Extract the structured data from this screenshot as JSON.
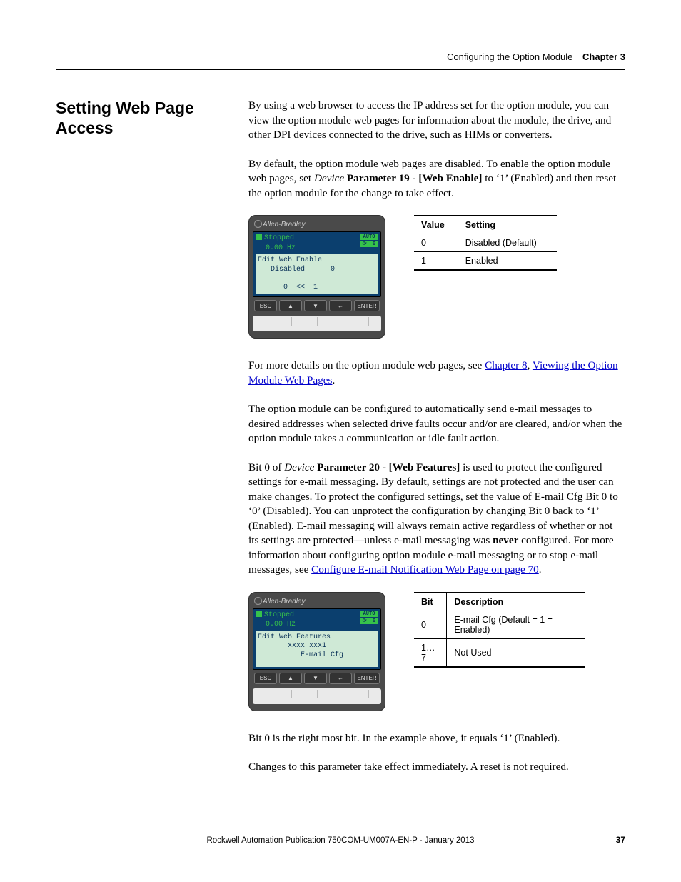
{
  "header": {
    "section": "Configuring the Option Module",
    "chapter": "Chapter 3"
  },
  "heading": "Setting Web Page Access",
  "p1": "By using a web browser to access the IP address set for the option module, you can view the option module web pages for information about the module, the drive, and other DPI devices connected to the drive, such as HIMs or converters.",
  "p2_a": "By default, the option module web pages are disabled. To enable the option module web pages, set ",
  "p2_device": "Device",
  "p2_param": " Parameter 19 - [Web Enable]",
  "p2_b": " to ‘1’ (Enabled) and then reset the option module for the change to take effect.",
  "him1": {
    "brand": "Allen-Bradley",
    "status1": "Stopped",
    "status2": "0.00 Hz",
    "badge1": "AUTO",
    "body": "Edit Web Enable\n   Disabled      0\n\n      0  <<  1",
    "keys": {
      "esc": "ESC",
      "up": "▲",
      "down": "▼",
      "left": "←",
      "enter": "ENTER"
    }
  },
  "table1": {
    "h1": "Value",
    "h2": "Setting",
    "rows": [
      {
        "v": "0",
        "s": "Disabled (Default)"
      },
      {
        "v": "1",
        "s": "Enabled"
      }
    ]
  },
  "p3_a": "For more details on the option module web pages, see ",
  "p3_link1": "Chapter 8",
  "p3_mid": ", ",
  "p3_link2": "Viewing the Option Module Web Pages",
  "p3_end": ".",
  "p4": "The option module can be configured to automatically send e-mail messages to desired addresses when selected drive faults occur and/or are cleared, and/or when the option module takes a communication or idle fault action.",
  "p5_a": "Bit 0 of ",
  "p5_device": "Device",
  "p5_param": " Parameter 20 - [Web Features]",
  "p5_b": " is used to protect the configured settings for e-mail messaging. By default, settings are not protected and the user can make changes. To protect the configured settings, set the value of E-mail Cfg Bit 0 to ‘0’ (Disabled). You can unprotect the configuration by changing Bit 0 back to ‘1’ (Enabled). E-mail messaging will always remain active regardless of whether or not its settings are protected—unless e-mail messaging was ",
  "p5_never": "never",
  "p5_c": " configured. For more information about configuring option module e-mail messaging or to stop e-mail messages, see ",
  "p5_link": "Configure E-mail Notification Web Page on page 70",
  "p5_end": ".",
  "him2": {
    "brand": "Allen-Bradley",
    "status1": "Stopped",
    "status2": "0.00 Hz",
    "badge1": "AUTO",
    "body": "Edit Web Features\n       xxxx xxx1\n          E-mail Cfg",
    "keys": {
      "esc": "ESC",
      "up": "▲",
      "down": "▼",
      "left": "←",
      "enter": "ENTER"
    }
  },
  "table2": {
    "h1": "Bit",
    "h2": "Description",
    "rows": [
      {
        "v": "0",
        "s": "E-mail Cfg (Default = 1 = Enabled)"
      },
      {
        "v": "1…7",
        "s": "Not Used"
      }
    ]
  },
  "p6": "Bit 0 is the right most bit. In the example above, it equals ‘1’ (Enabled).",
  "p7": "Changes to this parameter take effect immediately. A reset is not required.",
  "footer": "Rockwell Automation Publication 750COM-UM007A-EN-P - January 2013",
  "page_num": "37"
}
